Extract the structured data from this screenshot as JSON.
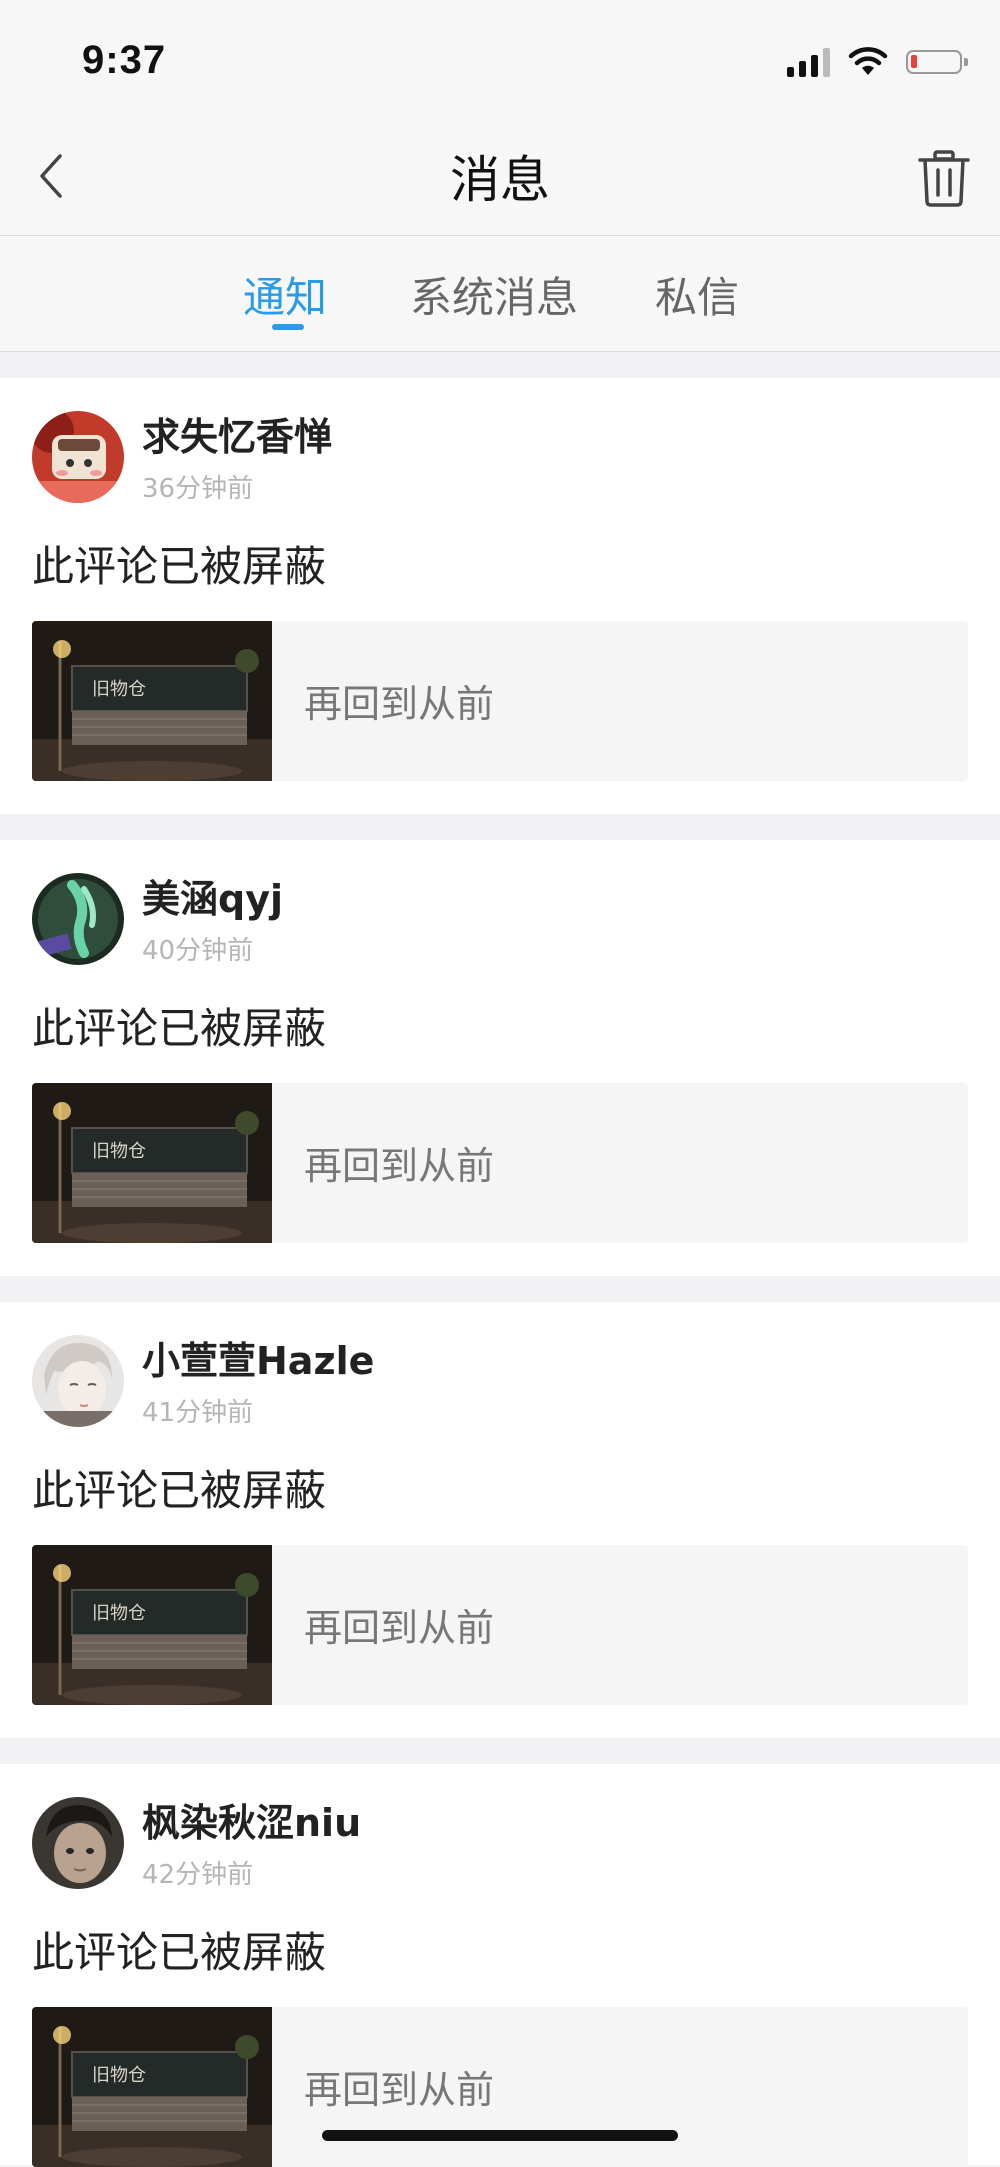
{
  "status": {
    "time": "9:37"
  },
  "nav": {
    "title": "消息"
  },
  "tabs": [
    {
      "label": "通知",
      "active": true
    },
    {
      "label": "系统消息",
      "active": false
    },
    {
      "label": "私信",
      "active": false
    }
  ],
  "notifications": [
    {
      "username": "求失忆香惮",
      "time": "36分钟前",
      "comment": "此评论已被屏蔽",
      "quote": "再回到从前",
      "avatar": "avatar-cartoon-red"
    },
    {
      "username": "美涵qyj",
      "time": "40分钟前",
      "comment": "此评论已被屏蔽",
      "quote": "再回到从前",
      "avatar": "avatar-butterfly"
    },
    {
      "username": "小萱萱Hazle",
      "time": "41分钟前",
      "comment": "此评论已被屏蔽",
      "quote": "再回到从前",
      "avatar": "avatar-anime-face"
    },
    {
      "username": "枫染秋涩niu",
      "time": "42分钟前",
      "comment": "此评论已被屏蔽",
      "quote": "再回到从前",
      "avatar": "avatar-portrait"
    }
  ],
  "colors": {
    "accent": "#2a9be6",
    "background": "#f2f2f4",
    "battery_low": "#e8403a"
  },
  "icons": [
    "back-chevron-icon",
    "trash-icon",
    "signal-icon",
    "wifi-icon",
    "battery-icon"
  ]
}
